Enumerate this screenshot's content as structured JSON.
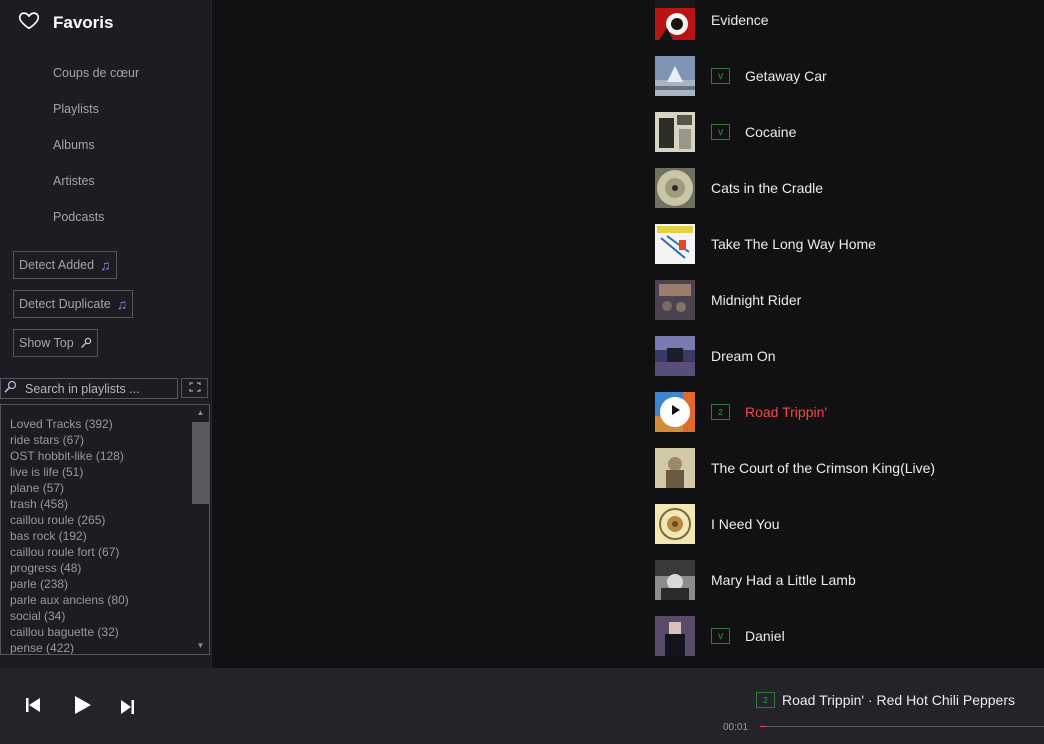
{
  "sidebar": {
    "title": "Favoris",
    "nav": [
      "Coups de cœur",
      "Playlists",
      "Albums",
      "Artistes",
      "Podcasts"
    ],
    "buttons": {
      "detect_added": "Detect Added",
      "detect_duplicate": "Detect Duplicate",
      "show_top": "Show Top"
    },
    "search": {
      "placeholder": "Search in playlists ..."
    },
    "playlists": [
      "Loved Tracks (392)",
      "ride stars (67)",
      "OST hobbit-like (128)",
      "live is life (51)",
      "plane (57)",
      "trash (458)",
      "caillou roule (265)",
      "bas rock (192)",
      "caillou roule fort (67)",
      "progress (48)",
      "parle (238)",
      "parle aux anciens (80)",
      "social (34)",
      "caillou baguette (32)",
      "pense (422)"
    ]
  },
  "tracks": [
    {
      "title": "Evidence",
      "tag": ""
    },
    {
      "title": "Getaway Car",
      "tag": "V"
    },
    {
      "title": "Cocaine",
      "tag": "V"
    },
    {
      "title": "Cats in the Cradle",
      "tag": ""
    },
    {
      "title": "Take The Long Way Home",
      "tag": ""
    },
    {
      "title": "Midnight Rider",
      "tag": ""
    },
    {
      "title": "Dream On",
      "tag": ""
    },
    {
      "title": "Road Trippin'",
      "tag": "2",
      "playing": true
    },
    {
      "title": "The Court of the Crimson King(Live)",
      "tag": ""
    },
    {
      "title": "I Need You",
      "tag": ""
    },
    {
      "title": "Mary Had a Little Lamb",
      "tag": ""
    },
    {
      "title": "Daniel",
      "tag": "V"
    }
  ],
  "player": {
    "now_playing_tag": "2",
    "now_playing": "Road Trippin' · Red Hot Chili Peppers",
    "elapsed": "00:01",
    "progress": 0.002
  },
  "colors": {
    "accent": "#f0484a",
    "tag_green": "#3fa34a",
    "note_purple": "#8d7ff0"
  }
}
